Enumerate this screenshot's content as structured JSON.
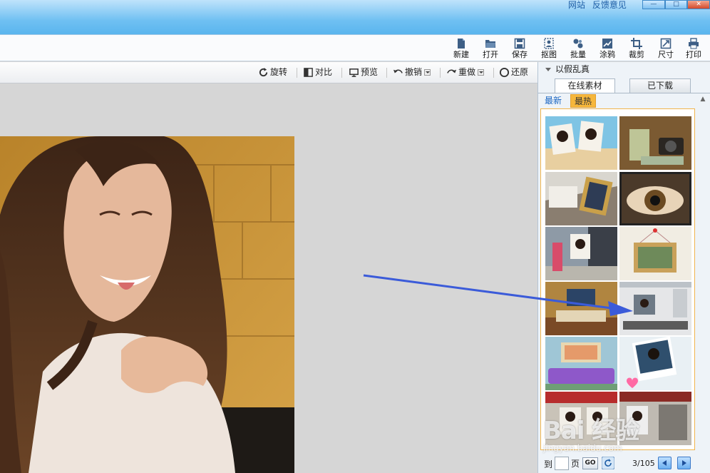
{
  "titlebar": {
    "links": [
      "网站",
      "反馈意见"
    ],
    "window_controls": [
      "minimize",
      "maximize",
      "close"
    ]
  },
  "toolbar": {
    "items": [
      {
        "label": "新建",
        "icon": "new-file-icon"
      },
      {
        "label": "打开",
        "icon": "folder-open-icon"
      },
      {
        "label": "保存",
        "icon": "save-icon"
      },
      {
        "label": "抠图",
        "icon": "cutout-icon"
      },
      {
        "label": "批量",
        "icon": "batch-icon"
      },
      {
        "label": "涂鸦",
        "icon": "doodle-icon"
      },
      {
        "label": "裁剪",
        "icon": "crop-icon"
      },
      {
        "label": "尺寸",
        "icon": "resize-icon"
      },
      {
        "label": "打印",
        "icon": "print-icon"
      }
    ]
  },
  "canvasbar": {
    "rotate": "旋转",
    "compare": "对比",
    "preview": "预览",
    "undo": "撤销",
    "redo": "重做",
    "restore": "还原"
  },
  "panel": {
    "title": "以假乱真",
    "tabs": [
      "在线素材",
      "已下载"
    ],
    "active_tab": "在线素材",
    "sort": [
      "最新",
      "最热"
    ],
    "active_sort": "最热",
    "thumbnails": [
      "photo-frame-beach",
      "photo-frame-glass-camera",
      "photo-frame-desk",
      "photo-frame-eye",
      "photo-frame-street",
      "photo-frame-wall-hanging",
      "photo-frame-hotel-room",
      "photo-frame-living-room",
      "photo-frame-purple-sofa",
      "photo-frame-heart",
      "photo-frame-storefront",
      "photo-frame-building"
    ],
    "pager": {
      "to_label": "到",
      "page_label": "页",
      "go_label": "GO",
      "page_value": "",
      "count": "3/105"
    }
  },
  "watermark": {
    "text": "Bai 经验",
    "url": "jingyan.baidu.com"
  },
  "colors": {
    "titlebar": "#6fc0f2",
    "arrow": "#3b5bd9",
    "active_sort": "#f6b73c",
    "gallery_border": "#f0b44c"
  }
}
